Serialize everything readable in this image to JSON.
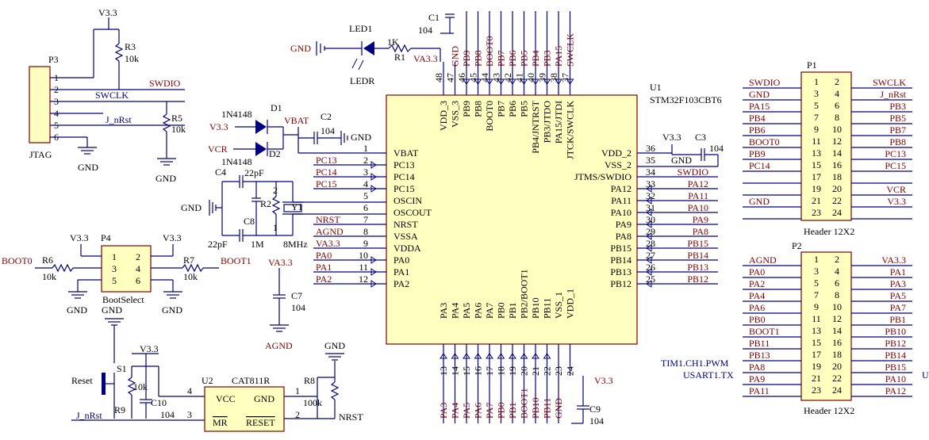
{
  "u1": {
    "ref": "U1",
    "part": "STM32F103CBT6",
    "left": [
      [
        "1",
        "VBAT"
      ],
      [
        "2",
        "PC13"
      ],
      [
        "3",
        "PC14"
      ],
      [
        "4",
        "PC15"
      ],
      [
        "5",
        "OSCIN"
      ],
      [
        "6",
        "OSCOUT"
      ],
      [
        "7",
        "NRST"
      ],
      [
        "8",
        "VSSA"
      ],
      [
        "9",
        "VDDA"
      ],
      [
        "10",
        "PA0"
      ],
      [
        "11",
        "PA1"
      ],
      [
        "12",
        "PA2"
      ]
    ],
    "right": [
      [
        "36",
        "VDD_2"
      ],
      [
        "35",
        "VSS_2"
      ],
      [
        "34",
        "JTMS/SWDIO"
      ],
      [
        "33",
        "PA12"
      ],
      [
        "32",
        "PA11"
      ],
      [
        "31",
        "PA10"
      ],
      [
        "30",
        "PA9"
      ],
      [
        "29",
        "PA8"
      ],
      [
        "28",
        "PB15"
      ],
      [
        "27",
        "PB14"
      ],
      [
        "26",
        "PB13"
      ],
      [
        "25",
        "PB12"
      ]
    ],
    "top": [
      [
        "48",
        "VDD_3"
      ],
      [
        "47",
        "VSS_3"
      ],
      [
        "46",
        "PB9"
      ],
      [
        "45",
        "PB8"
      ],
      [
        "44",
        "BOOT0"
      ],
      [
        "43",
        "PB7"
      ],
      [
        "42",
        "PB6"
      ],
      [
        "41",
        "PB5"
      ],
      [
        "40",
        "PB4/JNTRST"
      ],
      [
        "39",
        "PB3/JTDO"
      ],
      [
        "38",
        "PA15/JTDI"
      ],
      [
        "37",
        "JTCK/SWCLK"
      ]
    ],
    "bottom": [
      [
        "13",
        "PA3"
      ],
      [
        "14",
        "PA4"
      ],
      [
        "15",
        "PA5"
      ],
      [
        "16",
        "PA6"
      ],
      [
        "17",
        "PA7"
      ],
      [
        "18",
        "PB0"
      ],
      [
        "19",
        "PB1"
      ],
      [
        "20",
        "PB2/BOOT1"
      ],
      [
        "21",
        "PB10"
      ],
      [
        "22",
        "PB11"
      ],
      [
        "23",
        "VSS_1"
      ],
      [
        "24",
        "VDD_1"
      ]
    ],
    "left_nets": [
      "",
      "PC13",
      "PC14",
      "PC15",
      "",
      "",
      "NRST",
      "AGND",
      "VA3.3",
      "PA0",
      "PA1",
      "PA2"
    ],
    "right_nets": [
      "",
      "",
      "SWDIO",
      "PA12",
      "PA11",
      "PA10",
      "PA9",
      "PA8",
      "PB15",
      "PB14",
      "PB13",
      "PB12"
    ],
    "top_nets": [
      "",
      "GND",
      "PB9",
      "PB8",
      "BOOT0",
      "PB7",
      "PB6",
      "PB5",
      "PB4",
      "PB3",
      "PA15",
      "SWCLK"
    ],
    "bottom_nets": [
      "PA3",
      "PA4",
      "PA5",
      "PA6",
      "PA7",
      "PB0",
      "PB1",
      "BOOT1",
      "PB10",
      "PB11",
      "GND",
      ""
    ]
  },
  "p1": {
    "ref": "P1",
    "name": "Header 12X2",
    "odd": [
      "1",
      "3",
      "5",
      "7",
      "9",
      "11",
      "13",
      "15",
      "17",
      "19",
      "21",
      "23"
    ],
    "even": [
      "2",
      "4",
      "6",
      "8",
      "10",
      "12",
      "14",
      "16",
      "18",
      "20",
      "22",
      "24"
    ],
    "left": [
      "SWDIO",
      "GND",
      "PA15",
      "PB4",
      "PB6",
      "BOOT0",
      "PB9",
      "PC14",
      "",
      "",
      "GND",
      ""
    ],
    "right": [
      "SWCLK",
      "J_nRst",
      "PB3",
      "PB5",
      "PB7",
      "PB8",
      "PC13",
      "PC15",
      "",
      "VCR",
      "V3.3",
      ""
    ]
  },
  "p2": {
    "ref": "P2",
    "name": "Header 12X2",
    "odd": [
      "1",
      "3",
      "5",
      "7",
      "9",
      "11",
      "13",
      "15",
      "17",
      "19",
      "21",
      "23"
    ],
    "even": [
      "2",
      "4",
      "6",
      "8",
      "10",
      "12",
      "14",
      "16",
      "18",
      "20",
      "22",
      "24"
    ],
    "left": [
      "AGND",
      "PA0",
      "PA2",
      "PA4",
      "PA6",
      "PB0",
      "BOOT1",
      "PB11",
      "PB13",
      "PA8",
      "PA9",
      "PA11"
    ],
    "right": [
      "VA3.3",
      "PA1",
      "PA3",
      "PA5",
      "PA7",
      "PB1",
      "PB10",
      "PB12",
      "PB14",
      "PB15",
      "PA10",
      "PA12"
    ],
    "notes": [
      "TIM1.CH1.PWM",
      "USART1.TX"
    ],
    "edge_text": "U"
  },
  "p3": {
    "ref": "P3",
    "name": "JTAG",
    "pins": [
      "1",
      "2",
      "3",
      "4",
      "5",
      "6"
    ],
    "nets": [
      "SWDIO",
      "SWCLK",
      "J_nRst"
    ],
    "supply": "V3.3",
    "r3": [
      "R3",
      "10k"
    ],
    "r5": [
      "R5",
      "10k"
    ],
    "gnd_a": "GND",
    "gnd_b": "GND"
  },
  "p4": {
    "ref": "P4",
    "name": "BootSelect",
    "pins": [
      "1",
      "2",
      "3",
      "4",
      "5",
      "6"
    ],
    "v_left": "V3.3",
    "v_right": "V3.3",
    "r6": [
      "R6",
      "10k"
    ],
    "r7": [
      "R7",
      "10k"
    ],
    "boot0": "BOOT0",
    "boot1": "BOOT1",
    "gnd_a": "GND",
    "gnd_b": "GND"
  },
  "led": {
    "gnd": "GND",
    "ref": "LED1",
    "val": "LEDR",
    "r_ref": "R1",
    "r_val": "1K",
    "supply": "VA3.3"
  },
  "c1": {
    "ref": "C1",
    "val": "104",
    "gnd": "GND"
  },
  "diodes": {
    "d1": "D1",
    "d2": "D2",
    "part1": "1N4148",
    "part2": "1N4148",
    "v33": "V3.3",
    "vcr": "VCR",
    "vbat": "VBAT"
  },
  "c2": {
    "ref": "C2",
    "val": "104",
    "gnd": "GND"
  },
  "osc": {
    "c4": "C4",
    "c4v": "22pF",
    "c5v": "22pF",
    "c8": "C8",
    "r2": "R2",
    "r2v": "1M",
    "y1": "Y1",
    "y1v": "8MHz",
    "yp1": "1",
    "yp2": "2",
    "gnd": "GND"
  },
  "c7": {
    "supply": "VA3.3",
    "ref": "C7",
    "val": "104",
    "gnd": "AGND"
  },
  "c3": {
    "supply": "V3.3",
    "ref": "C3",
    "val": "104",
    "gnd": "GND"
  },
  "c9": {
    "supply": "V3.3",
    "ref": "C9",
    "val": "104"
  },
  "reset": {
    "gnd_top": "GND",
    "label": "Reset",
    "s1": "S1",
    "r9": "R9",
    "r9v": "10k",
    "c10": "C10",
    "c10v": "104",
    "supply": "V3.3",
    "jnrst": "J_nRst",
    "u2": "U2",
    "u2part": "CAT811R",
    "vcc": "VCC",
    "gnd": "GND",
    "mr": "MR",
    "rst": "RESET",
    "pin4": "4",
    "pin3": "3",
    "pin1": "1",
    "pin2": "2",
    "r8": "R8",
    "r8v": "100k",
    "gnd_r8": "GND",
    "nrst": "NRST"
  }
}
